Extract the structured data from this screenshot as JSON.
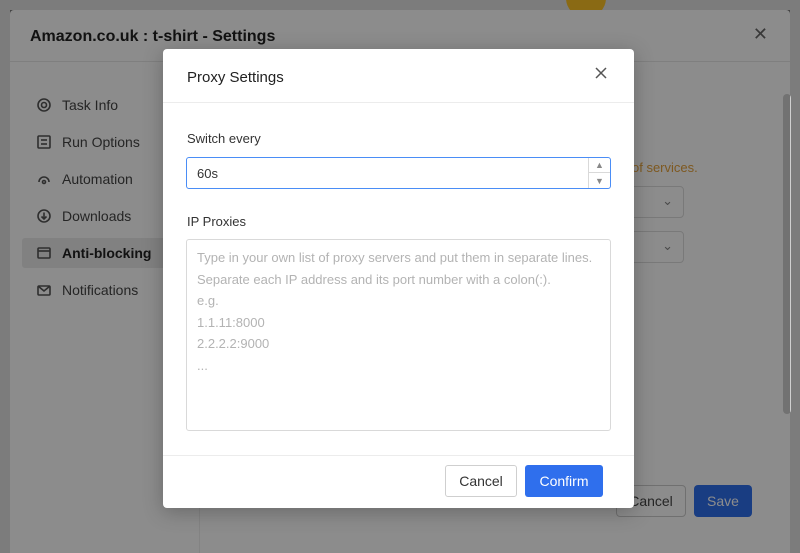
{
  "settings_dialog": {
    "title": "Amazon.co.uk : t-shirt - Settings",
    "close_glyph": "✕",
    "sidebar": [
      {
        "label": "Task Info",
        "icon": "gear-icon"
      },
      {
        "label": "Run Options",
        "icon": "list-icon"
      },
      {
        "label": "Automation",
        "icon": "automation-icon"
      },
      {
        "label": "Downloads",
        "icon": "download-icon"
      },
      {
        "label": "Anti-blocking",
        "icon": "shield-icon",
        "active": true
      },
      {
        "label": "Notifications",
        "icon": "mail-icon"
      }
    ],
    "warning_text": "of services.",
    "cancel_label": "Cancel",
    "save_label": "Save"
  },
  "proxy_modal": {
    "title": "Proxy Settings",
    "switch_label": "Switch every",
    "switch_value": "60s",
    "ip_label": "IP Proxies",
    "ip_placeholder": "Type in your own list of proxy servers and put them in separate lines.\nSeparate each IP address and its port number with a colon(:).\ne.g.\n1.1.11:8000\n2.2.2.2:9000\n...",
    "cancel_label": "Cancel",
    "confirm_label": "Confirm"
  },
  "colors": {
    "primary": "#2f6fed",
    "warning": "#e6a23c",
    "focus_border": "#4a8df6"
  }
}
